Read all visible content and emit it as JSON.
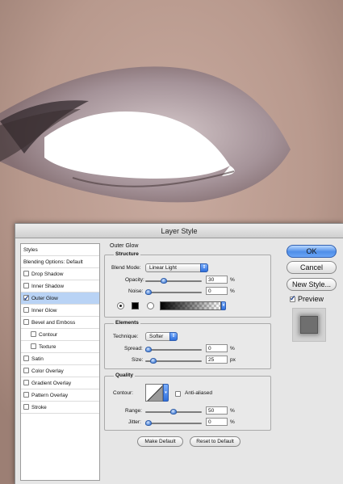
{
  "dialog": {
    "title": "Layer Style"
  },
  "stylelist": {
    "items": [
      {
        "label": "Styles",
        "checkbox": false,
        "checked": false,
        "selected": false,
        "sub": false
      },
      {
        "label": "Blending Options: Default",
        "checkbox": false,
        "checked": false,
        "selected": false,
        "sub": false
      },
      {
        "label": "Drop Shadow",
        "checkbox": true,
        "checked": false,
        "selected": false,
        "sub": false
      },
      {
        "label": "Inner Shadow",
        "checkbox": true,
        "checked": false,
        "selected": false,
        "sub": false
      },
      {
        "label": "Outer Glow",
        "checkbox": true,
        "checked": true,
        "selected": true,
        "sub": false
      },
      {
        "label": "Inner Glow",
        "checkbox": true,
        "checked": false,
        "selected": false,
        "sub": false
      },
      {
        "label": "Bevel and Emboss",
        "checkbox": true,
        "checked": false,
        "selected": false,
        "sub": false
      },
      {
        "label": "Contour",
        "checkbox": true,
        "checked": false,
        "selected": false,
        "sub": true
      },
      {
        "label": "Texture",
        "checkbox": true,
        "checked": false,
        "selected": false,
        "sub": true
      },
      {
        "label": "Satin",
        "checkbox": true,
        "checked": false,
        "selected": false,
        "sub": false
      },
      {
        "label": "Color Overlay",
        "checkbox": true,
        "checked": false,
        "selected": false,
        "sub": false
      },
      {
        "label": "Gradient Overlay",
        "checkbox": true,
        "checked": false,
        "selected": false,
        "sub": false
      },
      {
        "label": "Pattern Overlay",
        "checkbox": true,
        "checked": false,
        "selected": false,
        "sub": false
      },
      {
        "label": "Stroke",
        "checkbox": true,
        "checked": false,
        "selected": false,
        "sub": false
      }
    ]
  },
  "panel": {
    "title": "Outer Glow",
    "structure": {
      "title": "Structure",
      "blend_mode_label": "Blend Mode:",
      "blend_mode_value": "Linear Light",
      "opacity_label": "Opacity:",
      "opacity_value": "30",
      "opacity_fraction": 0.3,
      "noise_label": "Noise:",
      "noise_value": "0",
      "noise_fraction": 0,
      "percent": "%"
    },
    "elements": {
      "title": "Elements",
      "technique_label": "Technique:",
      "technique_value": "Softer",
      "spread_label": "Spread:",
      "spread_value": "0",
      "spread_fraction": 0,
      "size_label": "Size:",
      "size_value": "25",
      "size_fraction": 0.1,
      "percent": "%",
      "px": "px"
    },
    "quality": {
      "title": "Quality",
      "contour_label": "Contour:",
      "anti_aliased_label": "Anti-aliased",
      "anti_aliased_checked": false,
      "range_label": "Range:",
      "range_value": "50",
      "range_fraction": 0.5,
      "jitter_label": "Jitter:",
      "jitter_value": "0",
      "jitter_fraction": 0,
      "percent": "%"
    },
    "make_default_label": "Make Default",
    "reset_default_label": "Reset to Default"
  },
  "buttons": {
    "ok_label": "OK",
    "cancel_label": "Cancel",
    "new_style_label": "New Style...",
    "preview_label": "Preview",
    "preview_checked": true
  },
  "colors": {
    "accent": "#4f8ee8",
    "selection": "#b9d3f5",
    "glow_color": "#000000"
  }
}
